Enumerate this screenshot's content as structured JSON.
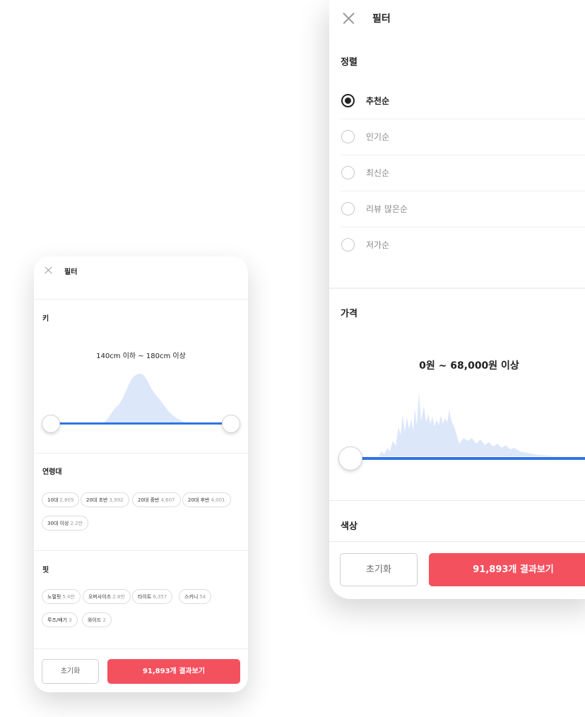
{
  "small": {
    "header": {
      "title": "필터",
      "close_icon": "close-icon"
    },
    "height": {
      "title": "키",
      "range_text": "140cm 이하 ~ 180cm 이상"
    },
    "age": {
      "title": "연령대",
      "chips": [
        {
          "label": "10대",
          "count": "2,805"
        },
        {
          "label": "20대 초반",
          "count": "3,992"
        },
        {
          "label": "20대 중반",
          "count": "4,607"
        },
        {
          "label": "20대 후반",
          "count": "4,001"
        },
        {
          "label": "30대 이상",
          "count": "2.2만"
        }
      ]
    },
    "fit": {
      "title": "핏",
      "chips": [
        {
          "label": "노멀핏",
          "count": "5.4만"
        },
        {
          "label": "오버사이즈",
          "count": "2.8만"
        },
        {
          "label": "타이트",
          "count": "6,357"
        },
        {
          "label": "스키니",
          "count": "54"
        },
        {
          "label": "루즈/배기",
          "count": "3"
        },
        {
          "label": "와이드",
          "count": "2"
        }
      ]
    },
    "footer": {
      "reset": "초기화",
      "apply": "91,893개 결과보기"
    }
  },
  "large": {
    "header": {
      "title": "필터",
      "close_icon": "close-icon"
    },
    "sort": {
      "title": "정렬",
      "options": [
        {
          "label": "추천순",
          "selected": true
        },
        {
          "label": "인기순",
          "selected": false
        },
        {
          "label": "최신순",
          "selected": false
        },
        {
          "label": "리뷰 많은순",
          "selected": false
        },
        {
          "label": "저가순",
          "selected": false
        }
      ]
    },
    "price": {
      "title": "가격",
      "range_text": "0원 ~ 68,000원 이상"
    },
    "color": {
      "title": "색상"
    },
    "footer": {
      "reset": "초기화",
      "apply": "91,893개 결과보기"
    }
  },
  "colors": {
    "accent": "#f4515f",
    "slider": "#2f74e6",
    "histogram": "#dce7fa"
  }
}
